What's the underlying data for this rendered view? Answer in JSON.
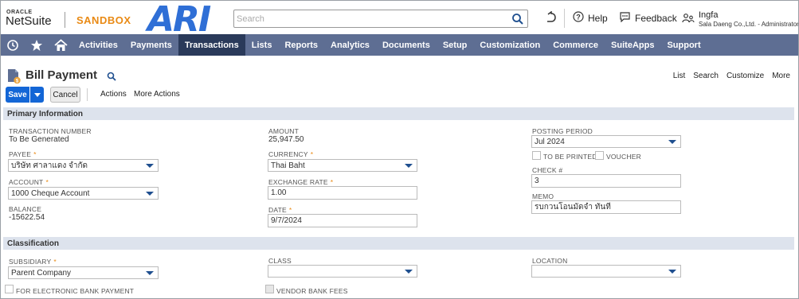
{
  "header": {
    "oracle": "ORACLE",
    "netsuite": "NetSuite",
    "sandbox": "SANDBOX",
    "logo_text": "ARI",
    "search_placeholder": "Search",
    "help": "Help",
    "feedback": "Feedback",
    "user_name": "Ingfa",
    "user_sub": "Sala Daeng Co.,Ltd. - Administrator"
  },
  "nav": {
    "items": [
      "Activities",
      "Payments",
      "Transactions",
      "Lists",
      "Reports",
      "Analytics",
      "Documents",
      "Setup",
      "Customization",
      "Commerce",
      "SuiteApps",
      "Support"
    ],
    "active": "Transactions"
  },
  "page": {
    "title": "Bill Payment",
    "links": [
      "List",
      "Search",
      "Customize",
      "More"
    ]
  },
  "toolbar": {
    "save": "Save",
    "cancel": "Cancel",
    "actions": "Actions",
    "more_actions": "More Actions"
  },
  "primary": {
    "section_title": "Primary Information",
    "transaction_number": {
      "label": "TRANSACTION NUMBER",
      "value": "To Be Generated"
    },
    "payee": {
      "label": "PAYEE",
      "value": "บริษัท ศาลาแดง จำกัด"
    },
    "account": {
      "label": "ACCOUNT",
      "value": "1000 Cheque Account"
    },
    "balance": {
      "label": "BALANCE",
      "value": "-15622.54"
    },
    "amount": {
      "label": "AMOUNT",
      "value": "25,947.50"
    },
    "currency": {
      "label": "CURRENCY",
      "value": "Thai Baht"
    },
    "exchange_rate": {
      "label": "EXCHANGE RATE",
      "value": "1.00"
    },
    "date": {
      "label": "DATE",
      "value": "9/7/2024"
    },
    "posting_period": {
      "label": "POSTING PERIOD",
      "value": "Jul 2024"
    },
    "to_be_printed": "TO BE PRINTED",
    "voucher": "VOUCHER",
    "check_no": {
      "label": "CHECK #",
      "value": "3"
    },
    "memo": {
      "label": "MEMO",
      "value": "รบกวนโอนมัดจำ ทันที"
    }
  },
  "classification": {
    "section_title": "Classification",
    "subsidiary": {
      "label": "SUBSIDIARY",
      "value": "Parent Company"
    },
    "class": {
      "label": "CLASS",
      "value": ""
    },
    "location": {
      "label": "LOCATION",
      "value": ""
    },
    "electronic_payment": "FOR ELECTRONIC BANK PAYMENT",
    "vendor_bank_fees": "VENDOR BANK FEES"
  },
  "colors": {
    "accent": "#1366d6",
    "nav_bg": "#5e6e93",
    "nav_active": "#2a3a5a",
    "sandbox": "#e98a15",
    "section_bg": "#dde3ed"
  }
}
